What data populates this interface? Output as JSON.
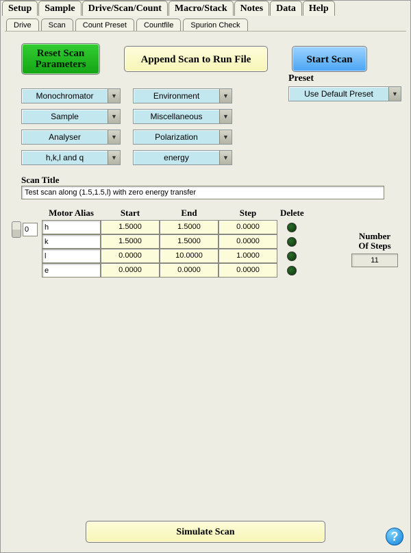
{
  "main_tabs": [
    "Setup",
    "Sample",
    "Drive/Scan/Count",
    "Macro/Stack",
    "Notes",
    "Data",
    "Help"
  ],
  "sub_tabs": [
    "Drive",
    "Scan",
    "Count Preset",
    "Countfile",
    "Spurion Check"
  ],
  "active_sub_tab": "Scan",
  "buttons": {
    "reset": "Reset Scan Parameters",
    "append": "Append Scan to Run File",
    "start": "Start Scan",
    "simulate": "Simulate Scan"
  },
  "dropdowns_left": [
    "Monochromator",
    "Sample",
    "Analyser",
    "h,k,l and q"
  ],
  "dropdowns_right": [
    "Environment",
    "Miscellaneous",
    "Polarization",
    "energy"
  ],
  "preset": {
    "label": "Preset",
    "value": "Use Default Preset"
  },
  "scan_title": {
    "label": "Scan Title",
    "value": "Test scan along (1.5,1.5,l) with zero energy transfer"
  },
  "index_value": "0",
  "columns": [
    "Motor Alias",
    "Start",
    "End",
    "Step",
    "Delete"
  ],
  "rows": [
    {
      "alias": "h",
      "start": "1.5000",
      "end": "1.5000",
      "step": "0.0000"
    },
    {
      "alias": "k",
      "start": "1.5000",
      "end": "1.5000",
      "step": "0.0000"
    },
    {
      "alias": "l",
      "start": "0.0000",
      "end": "10.0000",
      "step": "1.0000"
    },
    {
      "alias": "e",
      "start": "0.0000",
      "end": "0.0000",
      "step": "0.0000"
    }
  ],
  "steps": {
    "label1": "Number",
    "label2": "Of Steps",
    "value": "11"
  },
  "help_glyph": "?"
}
